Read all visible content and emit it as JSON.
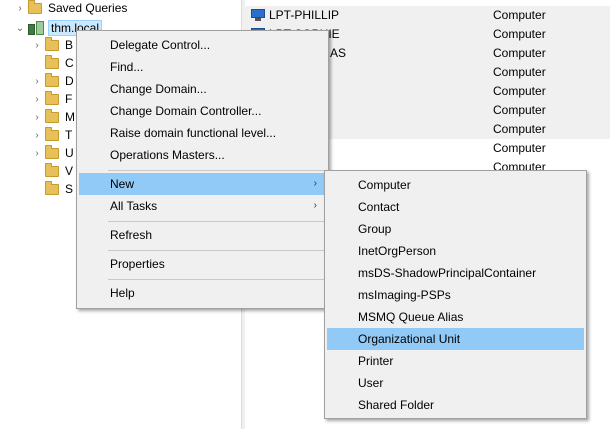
{
  "tree": {
    "saved_queries": "Saved Queries",
    "domain": "thm.local",
    "children": [
      "B",
      "C",
      "D",
      "F",
      "M",
      "T",
      "U",
      "V",
      "S"
    ]
  },
  "list": {
    "rows": [
      {
        "name": "LPT-PHILLIP",
        "type": "Computer"
      },
      {
        "name": "LPT-SOPHIE",
        "type": "Computer"
      },
      {
        "name": "AS",
        "type": "Computer"
      },
      {
        "name": "",
        "type": "Computer"
      },
      {
        "name": "",
        "type": "Computer"
      },
      {
        "name": "",
        "type": "Computer"
      },
      {
        "name": "",
        "type": "Computer"
      },
      {
        "name": "",
        "type": "Computer"
      },
      {
        "name": "",
        "type": "Computer"
      }
    ]
  },
  "context_menu": {
    "items": [
      "Delegate Control...",
      "Find...",
      "Change Domain...",
      "Change Domain Controller...",
      "Raise domain functional level...",
      "Operations Masters...",
      "New",
      "All Tasks",
      "Refresh",
      "Properties",
      "Help"
    ]
  },
  "new_submenu": {
    "items": [
      "Computer",
      "Contact",
      "Group",
      "InetOrgPerson",
      "msDS-ShadowPrincipalContainer",
      "msImaging-PSPs",
      "MSMQ Queue Alias",
      "Organizational Unit",
      "Printer",
      "User",
      "Shared Folder"
    ],
    "highlighted": "Organizational Unit"
  },
  "glyphs": {
    "chevron_right": "›",
    "chevron_down": "⌄",
    "submenu_arrow": "›"
  },
  "colors": {
    "menu_bg": "#f0f0f0",
    "menu_highlight": "#91c9f7",
    "tree_selection": "#cce8ff"
  }
}
